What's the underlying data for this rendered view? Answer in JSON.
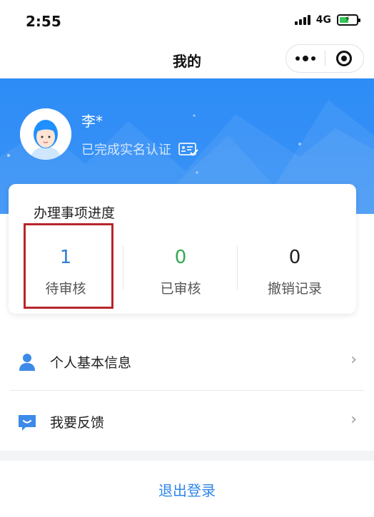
{
  "status_bar": {
    "time": "2:55",
    "network": "4G",
    "battery_level": 0.55,
    "battery_color": "#35c759"
  },
  "nav": {
    "title": "我的",
    "more_icon": "more-dots-icon",
    "close_icon": "mini-program-close-icon"
  },
  "profile": {
    "name": "李*",
    "verify_status": "已完成实名认证",
    "verify_icon": "id-card-check-icon",
    "header_color": "#2d8cf6"
  },
  "progress": {
    "title": "办理事项进度",
    "items": [
      {
        "value": "1",
        "label": "待审核",
        "color": "#2f7fd2"
      },
      {
        "value": "0",
        "label": "已审核",
        "color": "#35a853"
      },
      {
        "value": "0",
        "label": "撤销记录",
        "color": "#222222"
      }
    ],
    "highlight_color": "#b8262a"
  },
  "menu": [
    {
      "label": "个人基本信息",
      "icon": "person-icon"
    },
    {
      "label": "我要反馈",
      "icon": "feedback-icon"
    }
  ],
  "logout": {
    "label": "退出登录",
    "color": "#2d86ea"
  }
}
